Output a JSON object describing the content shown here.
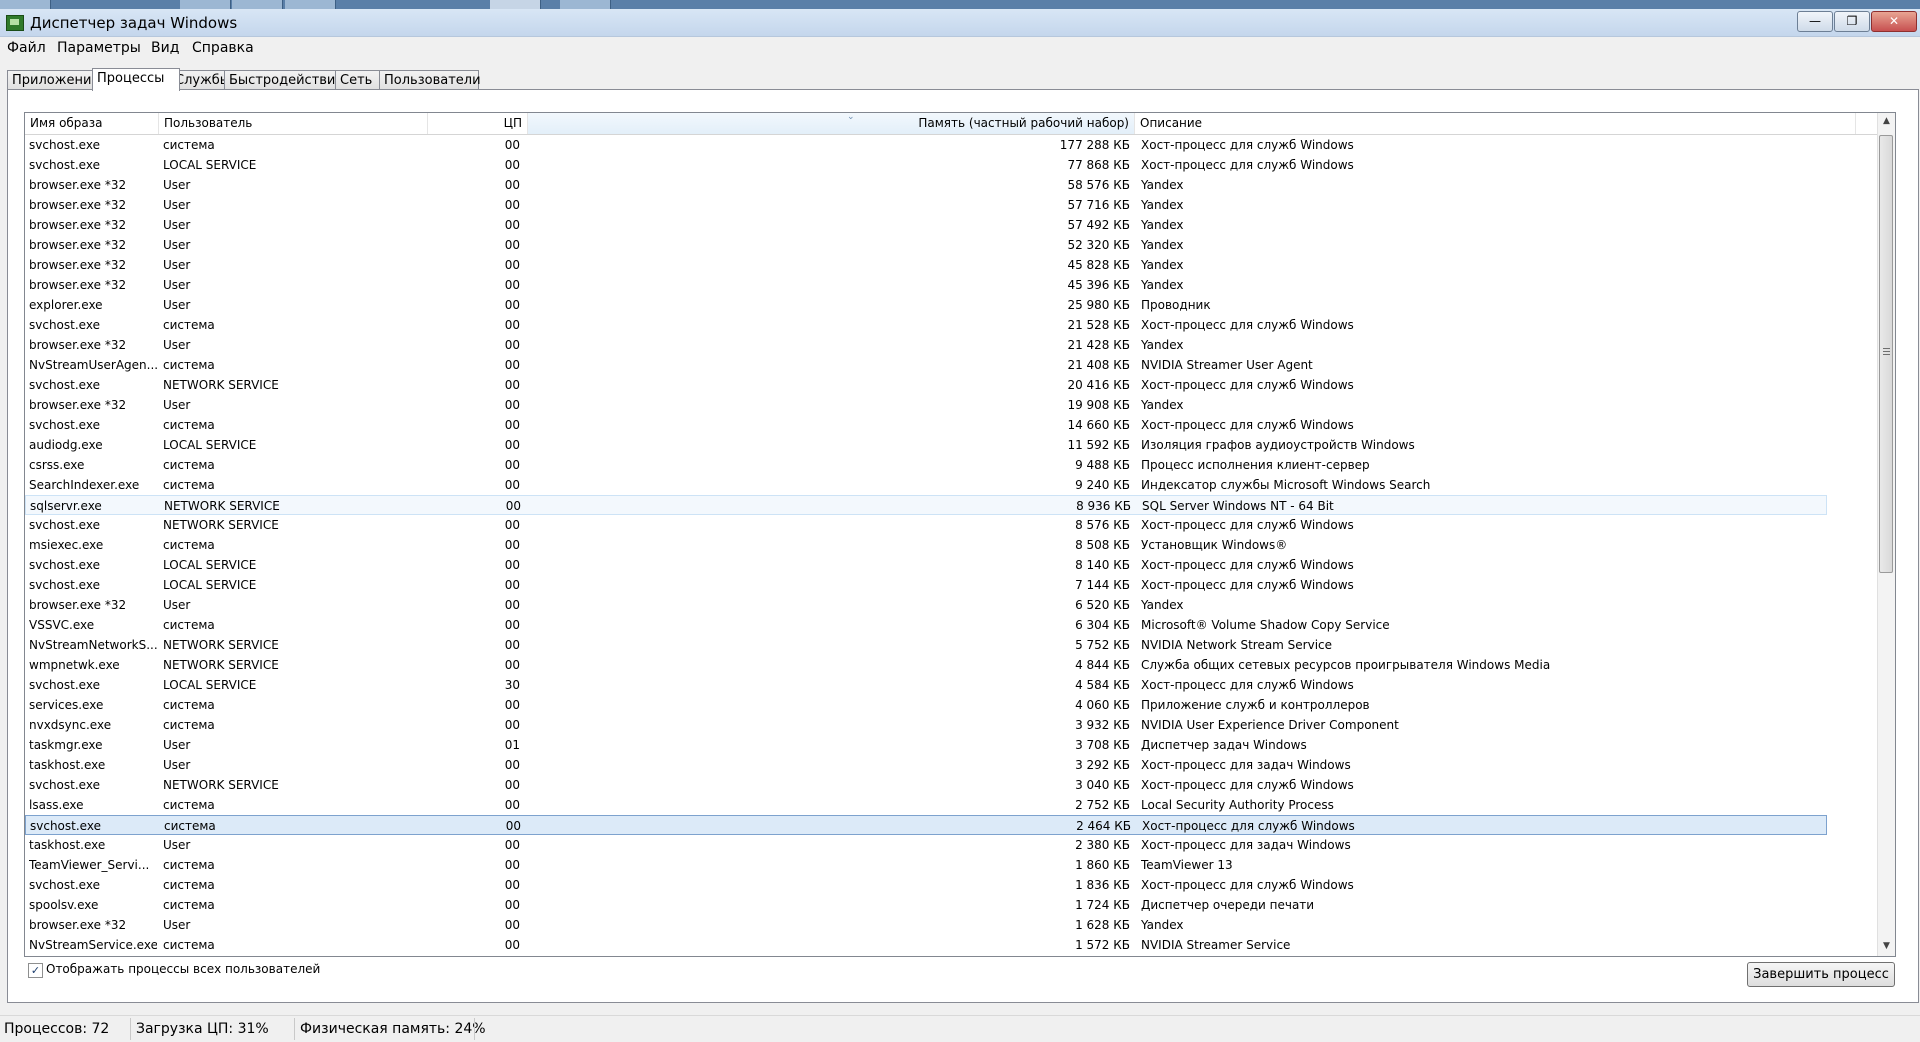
{
  "window": {
    "title": "Диспетчер задач Windows",
    "buttons": {
      "minimize": "—",
      "maximize": "❐",
      "close": "✕"
    }
  },
  "menu": [
    {
      "label": "Файл"
    },
    {
      "label": "Параметры"
    },
    {
      "label": "Вид"
    },
    {
      "label": "Справка"
    }
  ],
  "tabs": [
    {
      "label": "Приложения"
    },
    {
      "label": "Процессы"
    },
    {
      "label": "Службы"
    },
    {
      "label": "Быстродействие"
    },
    {
      "label": "Сеть"
    },
    {
      "label": "Пользователи"
    }
  ],
  "active_tab": "Процессы",
  "columns": {
    "name": "Имя образа",
    "user": "Пользователь",
    "cpu": "ЦП",
    "memory": "Память (частный рабочий набор)",
    "description": "Описание"
  },
  "processes": [
    {
      "name": "svchost.exe",
      "user": "система",
      "cpu": "00",
      "mem": "177 288 КБ",
      "desc": "Хост-процесс для служб Windows"
    },
    {
      "name": "svchost.exe",
      "user": "LOCAL SERVICE",
      "cpu": "00",
      "mem": "77 868 КБ",
      "desc": "Хост-процесс для служб Windows"
    },
    {
      "name": "browser.exe *32",
      "user": "User",
      "cpu": "00",
      "mem": "58 576 КБ",
      "desc": "Yandex"
    },
    {
      "name": "browser.exe *32",
      "user": "User",
      "cpu": "00",
      "mem": "57 716 КБ",
      "desc": "Yandex"
    },
    {
      "name": "browser.exe *32",
      "user": "User",
      "cpu": "00",
      "mem": "57 492 КБ",
      "desc": "Yandex"
    },
    {
      "name": "browser.exe *32",
      "user": "User",
      "cpu": "00",
      "mem": "52 320 КБ",
      "desc": "Yandex"
    },
    {
      "name": "browser.exe *32",
      "user": "User",
      "cpu": "00",
      "mem": "45 828 КБ",
      "desc": "Yandex"
    },
    {
      "name": "browser.exe *32",
      "user": "User",
      "cpu": "00",
      "mem": "45 396 КБ",
      "desc": "Yandex"
    },
    {
      "name": "explorer.exe",
      "user": "User",
      "cpu": "00",
      "mem": "25 980 КБ",
      "desc": "Проводник"
    },
    {
      "name": "svchost.exe",
      "user": "система",
      "cpu": "00",
      "mem": "21 528 КБ",
      "desc": "Хост-процесс для служб Windows"
    },
    {
      "name": "browser.exe *32",
      "user": "User",
      "cpu": "00",
      "mem": "21 428 КБ",
      "desc": "Yandex"
    },
    {
      "name": "NvStreamUserAgen...",
      "user": "система",
      "cpu": "00",
      "mem": "21 408 КБ",
      "desc": "NVIDIA Streamer User Agent"
    },
    {
      "name": "svchost.exe",
      "user": "NETWORK SERVICE",
      "cpu": "00",
      "mem": "20 416 КБ",
      "desc": "Хост-процесс для служб Windows"
    },
    {
      "name": "browser.exe *32",
      "user": "User",
      "cpu": "00",
      "mem": "19 908 КБ",
      "desc": "Yandex"
    },
    {
      "name": "svchost.exe",
      "user": "система",
      "cpu": "00",
      "mem": "14 660 КБ",
      "desc": "Хост-процесс для служб Windows"
    },
    {
      "name": "audiodg.exe",
      "user": "LOCAL SERVICE",
      "cpu": "00",
      "mem": "11 592 КБ",
      "desc": "Изоляция графов аудиоустройств Windows"
    },
    {
      "name": "csrss.exe",
      "user": "система",
      "cpu": "00",
      "mem": "9 488 КБ",
      "desc": "Процесс исполнения клиент-сервер"
    },
    {
      "name": "SearchIndexer.exe",
      "user": "система",
      "cpu": "00",
      "mem": "9 240 КБ",
      "desc": "Индексатор службы Microsoft Windows Search"
    },
    {
      "name": "sqlservr.exe",
      "user": "NETWORK SERVICE",
      "cpu": "00",
      "mem": "8 936 КБ",
      "desc": "SQL Server Windows NT - 64 Bit",
      "state": "hover"
    },
    {
      "name": "svchost.exe",
      "user": "NETWORK SERVICE",
      "cpu": "00",
      "mem": "8 576 КБ",
      "desc": "Хост-процесс для служб Windows"
    },
    {
      "name": "msiexec.exe",
      "user": "система",
      "cpu": "00",
      "mem": "8 508 КБ",
      "desc": "Установщик Windows®"
    },
    {
      "name": "svchost.exe",
      "user": "LOCAL SERVICE",
      "cpu": "00",
      "mem": "8 140 КБ",
      "desc": "Хост-процесс для служб Windows"
    },
    {
      "name": "svchost.exe",
      "user": "LOCAL SERVICE",
      "cpu": "00",
      "mem": "7 144 КБ",
      "desc": "Хост-процесс для служб Windows"
    },
    {
      "name": "browser.exe *32",
      "user": "User",
      "cpu": "00",
      "mem": "6 520 КБ",
      "desc": "Yandex"
    },
    {
      "name": "VSSVC.exe",
      "user": "система",
      "cpu": "00",
      "mem": "6 304 КБ",
      "desc": "Microsoft® Volume Shadow Copy Service"
    },
    {
      "name": "NvStreamNetworkS...",
      "user": "NETWORK SERVICE",
      "cpu": "00",
      "mem": "5 752 КБ",
      "desc": "NVIDIA Network Stream Service"
    },
    {
      "name": "wmpnetwk.exe",
      "user": "NETWORK SERVICE",
      "cpu": "00",
      "mem": "4 844 КБ",
      "desc": "Служба общих сетевых ресурсов проигрывателя Windows Media"
    },
    {
      "name": "svchost.exe",
      "user": "LOCAL SERVICE",
      "cpu": "30",
      "mem": "4 584 КБ",
      "desc": "Хост-процесс для служб Windows"
    },
    {
      "name": "services.exe",
      "user": "система",
      "cpu": "00",
      "mem": "4 060 КБ",
      "desc": "Приложение служб и контроллеров"
    },
    {
      "name": "nvxdsync.exe",
      "user": "система",
      "cpu": "00",
      "mem": "3 932 КБ",
      "desc": "NVIDIA User Experience Driver Component"
    },
    {
      "name": "taskmgr.exe",
      "user": "User",
      "cpu": "01",
      "mem": "3 708 КБ",
      "desc": "Диспетчер задач Windows"
    },
    {
      "name": "taskhost.exe",
      "user": "User",
      "cpu": "00",
      "mem": "3 292 КБ",
      "desc": "Хост-процесс для задач Windows"
    },
    {
      "name": "svchost.exe",
      "user": "NETWORK SERVICE",
      "cpu": "00",
      "mem": "3 040 КБ",
      "desc": "Хост-процесс для служб Windows"
    },
    {
      "name": "lsass.exe",
      "user": "система",
      "cpu": "00",
      "mem": "2 752 КБ",
      "desc": "Local Security Authority Process"
    },
    {
      "name": "svchost.exe",
      "user": "система",
      "cpu": "00",
      "mem": "2 464 КБ",
      "desc": "Хост-процесс для служб Windows",
      "state": "selected"
    },
    {
      "name": "taskhost.exe",
      "user": "User",
      "cpu": "00",
      "mem": "2 380 КБ",
      "desc": "Хост-процесс для задач Windows"
    },
    {
      "name": "TeamViewer_Servi...",
      "user": "система",
      "cpu": "00",
      "mem": "1 860 КБ",
      "desc": "TeamViewer 13"
    },
    {
      "name": "svchost.exe",
      "user": "система",
      "cpu": "00",
      "mem": "1 836 КБ",
      "desc": "Хост-процесс для служб Windows"
    },
    {
      "name": "spoolsv.exe",
      "user": "система",
      "cpu": "00",
      "mem": "1 724 КБ",
      "desc": "Диспетчер очереди печати"
    },
    {
      "name": "browser.exe *32",
      "user": "User",
      "cpu": "00",
      "mem": "1 628 КБ",
      "desc": "Yandex"
    },
    {
      "name": "NvStreamService.exe",
      "user": "система",
      "cpu": "00",
      "mem": "1 572 КБ",
      "desc": "NVIDIA Streamer Service"
    }
  ],
  "show_all_users": {
    "label": "Отображать процессы всех пользователей",
    "checked": true
  },
  "end_process_button": "Завершить процесс",
  "status": {
    "processes": "Процессов: 72",
    "cpu": "Загрузка ЦП: 31%",
    "memory": "Физическая память: 24%"
  },
  "colors": {
    "selection": "#dceaf8",
    "selection_border": "#7da2ce",
    "hover": "#f3f8fd"
  }
}
